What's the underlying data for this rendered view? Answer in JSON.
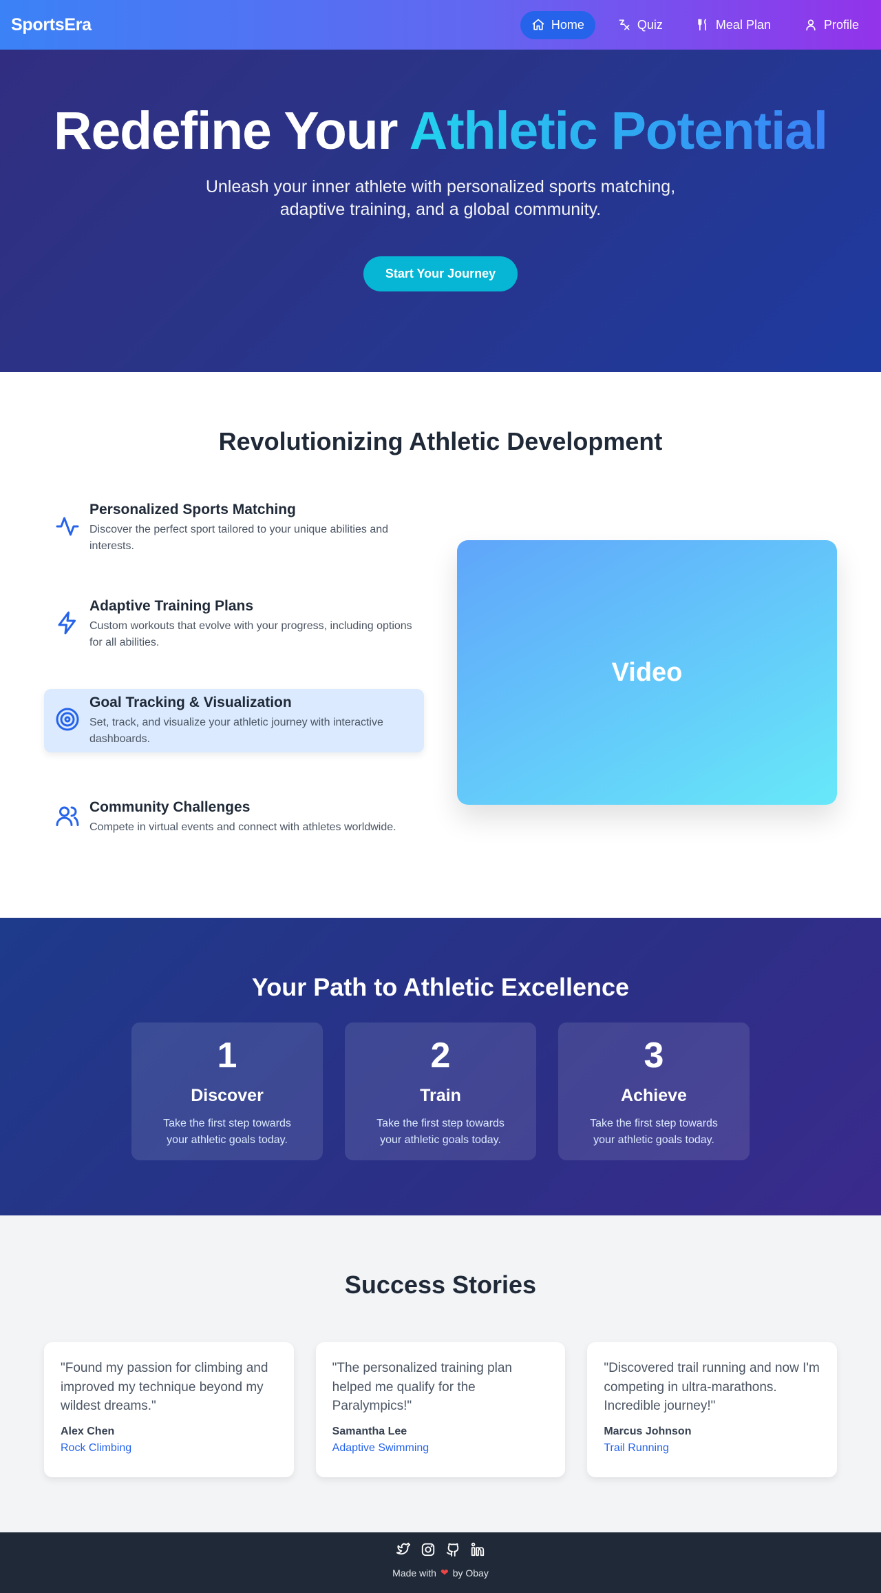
{
  "nav": {
    "brand": "SportsEra",
    "items": [
      {
        "label": "Home",
        "icon": "home-icon",
        "active": true
      },
      {
        "label": "Quiz",
        "icon": "quiz-icon"
      },
      {
        "label": "Meal Plan",
        "icon": "utensils-icon"
      },
      {
        "label": "Profile",
        "icon": "user-icon"
      }
    ]
  },
  "hero": {
    "title_plain": "Redefine Your ",
    "title_accent": "Athletic Potential",
    "subtitle": "Unleash your inner athlete with personalized sports matching, adaptive training, and a global community.",
    "cta": "Start Your Journey"
  },
  "features": {
    "title": "Revolutionizing Athletic Development",
    "items": [
      {
        "icon": "activity-icon",
        "title": "Personalized Sports Matching",
        "desc": "Discover the perfect sport tailored to your unique abilities and interests."
      },
      {
        "icon": "zap-icon",
        "title": "Adaptive Training Plans",
        "desc": "Custom workouts that evolve with your progress, including options for all abilities."
      },
      {
        "icon": "target-icon",
        "title": "Goal Tracking & Visualization",
        "desc": "Set, track, and visualize your athletic journey with interactive dashboards.",
        "active": true
      },
      {
        "icon": "users-icon",
        "title": "Community Challenges",
        "desc": "Compete in virtual events and connect with athletes worldwide."
      }
    ],
    "video_label": "Video"
  },
  "path": {
    "title": "Your Path to Athletic Excellence",
    "steps": [
      {
        "num": "1",
        "label": "Discover",
        "desc": "Take the first step towards your athletic goals today."
      },
      {
        "num": "2",
        "label": "Train",
        "desc": "Take the first step towards your athletic goals today."
      },
      {
        "num": "3",
        "label": "Achieve",
        "desc": "Take the first step towards your athletic goals today."
      }
    ]
  },
  "stories": {
    "title": "Success Stories",
    "items": [
      {
        "quote": "\"Found my passion for climbing and improved my technique beyond my wildest dreams.\"",
        "name": "Alex Chen",
        "sport": "Rock Climbing"
      },
      {
        "quote": "\"The personalized training plan helped me qualify for the Paralympics!\"",
        "name": "Samantha Lee",
        "sport": "Adaptive Swimming"
      },
      {
        "quote": "\"Discovered trail running and now I'm competing in ultra-marathons. Incredible journey!\"",
        "name": "Marcus Johnson",
        "sport": "Trail Running"
      }
    ]
  },
  "footer": {
    "socials": [
      "twitter-icon",
      "instagram-icon",
      "github-icon",
      "linkedin-icon"
    ],
    "made_prefix": "Made with",
    "made_suffix": "by Obay"
  },
  "colors": {
    "accent": "#2563eb",
    "cta": "#06b6d4",
    "hero_bg": "#2a3487",
    "footer_bg": "#1f2937"
  }
}
